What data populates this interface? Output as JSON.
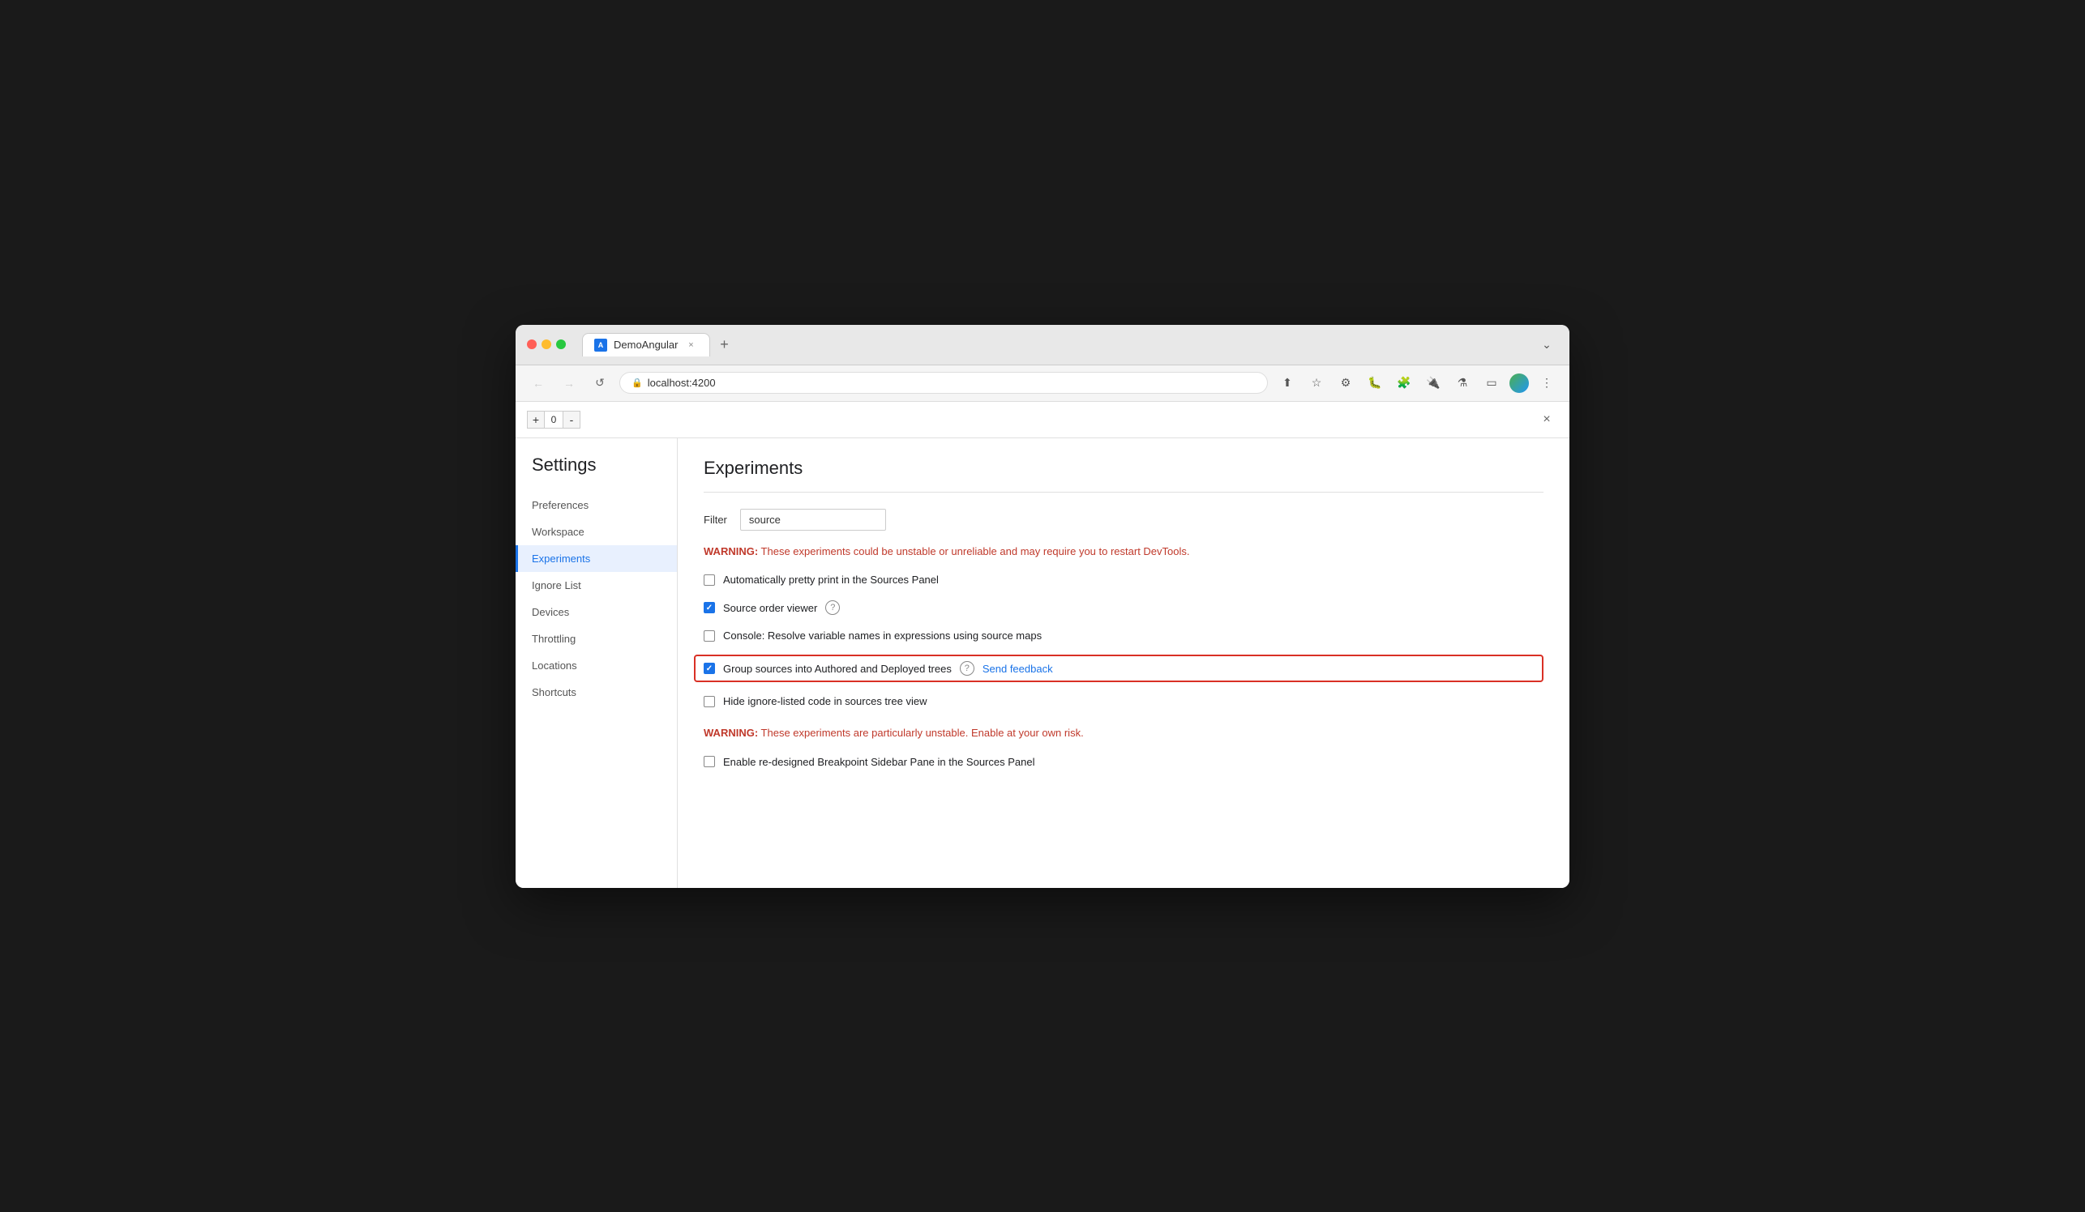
{
  "browser": {
    "tab_title": "DemoAngular",
    "tab_favicon": "A",
    "close_label": "×",
    "new_tab_label": "+",
    "back_label": "←",
    "forward_label": "→",
    "reload_label": "↺",
    "address": "localhost:4200",
    "more_label": "⋮",
    "dropdown_label": "⌄"
  },
  "devtools": {
    "counter": "0",
    "counter_plus": "+",
    "counter_minus": "-",
    "close_label": "×"
  },
  "settings": {
    "title": "Settings",
    "sidebar_items": [
      {
        "id": "preferences",
        "label": "Preferences",
        "active": false
      },
      {
        "id": "workspace",
        "label": "Workspace",
        "active": false
      },
      {
        "id": "experiments",
        "label": "Experiments",
        "active": true
      },
      {
        "id": "ignore-list",
        "label": "Ignore List",
        "active": false
      },
      {
        "id": "devices",
        "label": "Devices",
        "active": false
      },
      {
        "id": "throttling",
        "label": "Throttling",
        "active": false
      },
      {
        "id": "locations",
        "label": "Locations",
        "active": false
      },
      {
        "id": "shortcuts",
        "label": "Shortcuts",
        "active": false
      }
    ]
  },
  "experiments": {
    "title": "Experiments",
    "filter_label": "Filter",
    "filter_value": "source",
    "warning1_label": "WARNING:",
    "warning1_body": " These experiments could be unstable or unreliable and may require you to restart DevTools.",
    "experiments": [
      {
        "id": "pretty-print",
        "label": "Automatically pretty print in the Sources Panel",
        "checked": false,
        "highlighted": false,
        "has_help": false,
        "has_feedback": false
      },
      {
        "id": "source-order-viewer",
        "label": "Source order viewer",
        "checked": true,
        "highlighted": false,
        "has_help": true,
        "has_feedback": false
      },
      {
        "id": "console-resolve",
        "label": "Console: Resolve variable names in expressions using source maps",
        "checked": false,
        "highlighted": false,
        "has_help": false,
        "has_feedback": false
      },
      {
        "id": "group-sources",
        "label": "Group sources into Authored and Deployed trees",
        "checked": true,
        "highlighted": true,
        "has_help": true,
        "has_feedback": true,
        "feedback_label": "Send feedback"
      },
      {
        "id": "hide-ignore",
        "label": "Hide ignore-listed code in sources tree view",
        "checked": false,
        "highlighted": false,
        "has_help": false,
        "has_feedback": false
      }
    ],
    "warning2_label": "WARNING:",
    "warning2_body": " These experiments are particularly unstable. Enable at your own risk.",
    "unstable_experiments": [
      {
        "id": "breakpoint-sidebar",
        "label": "Enable re-designed Breakpoint Sidebar Pane in the Sources Panel",
        "checked": false
      }
    ],
    "help_icon": "?",
    "colors": {
      "warning": "#c0392b",
      "link": "#1a73e8",
      "highlight_border": "#d93025"
    }
  }
}
